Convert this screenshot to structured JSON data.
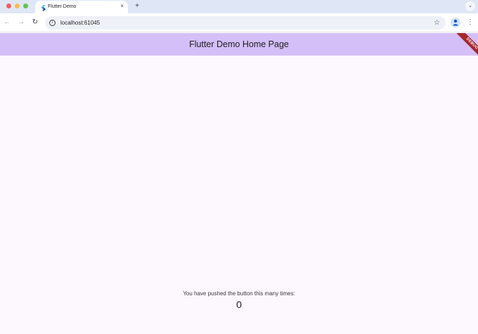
{
  "browser": {
    "tab": {
      "title": "Flutter Demo",
      "favicon": "flutter-logo-icon",
      "close_glyph": "×"
    },
    "new_tab_glyph": "+",
    "tab_search_glyph": "⌄",
    "toolbar": {
      "back_glyph": "←",
      "forward_glyph": "→",
      "reload_glyph": "↻",
      "url": "localhost:61045",
      "site_info_glyph": "i",
      "bookmark_glyph": "☆",
      "menu_glyph": "⋮"
    }
  },
  "app": {
    "title": "Flutter Demo Home Page",
    "debug_banner": "DEBUG",
    "counter_label": "You have pushed the button this many times:",
    "counter_value": "0"
  },
  "colors": {
    "appbar": "#d4bff8",
    "background": "#fdf7fe",
    "debug_banner": "#a5282d",
    "tabstrip": "#dfe7f6"
  }
}
